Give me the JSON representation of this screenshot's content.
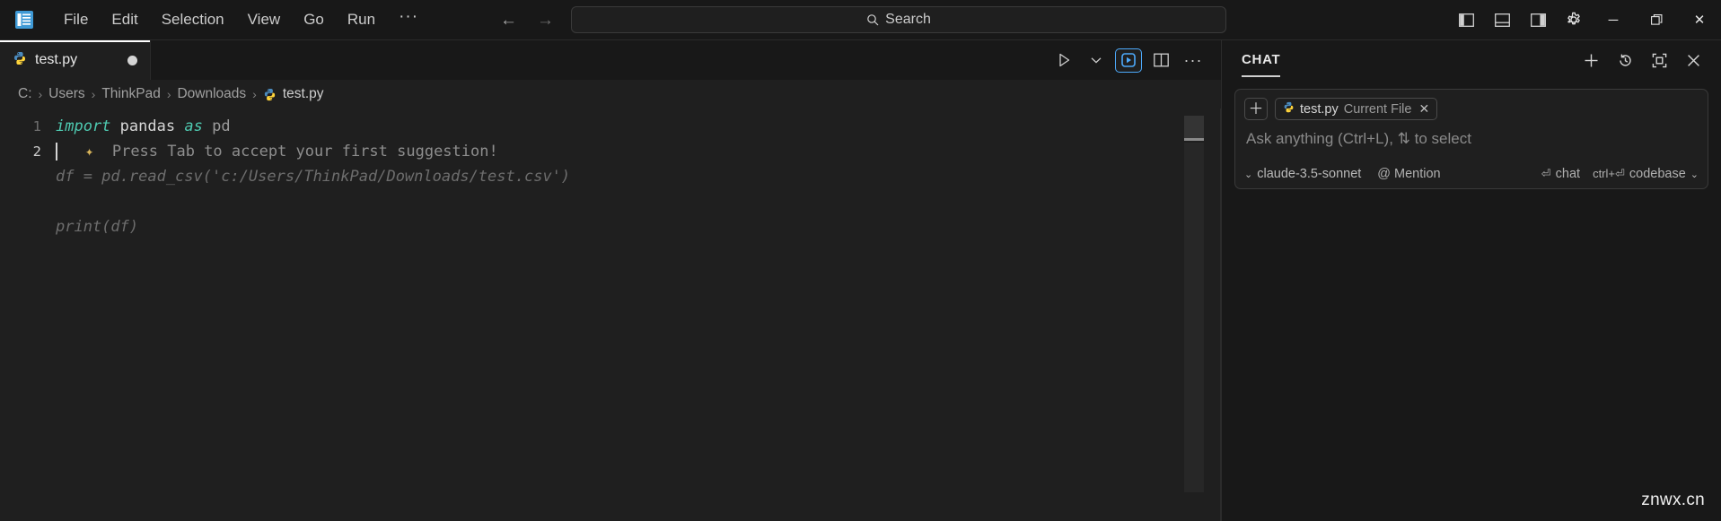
{
  "titlebar": {
    "logo_icon": "vscode-logo-icon",
    "menu": [
      {
        "label": "File",
        "name": "menu-file"
      },
      {
        "label": "Edit",
        "name": "menu-edit"
      },
      {
        "label": "Selection",
        "name": "menu-selection"
      },
      {
        "label": "View",
        "name": "menu-view"
      },
      {
        "label": "Go",
        "name": "menu-go"
      },
      {
        "label": "Run",
        "name": "menu-run"
      }
    ],
    "menu_overflow": "···",
    "nav": {
      "back": "←",
      "forward": "→"
    },
    "search": {
      "label": "Search",
      "icon": "search-icon"
    },
    "layout_icons": [
      "toggle-primary-sidebar-icon",
      "toggle-panel-icon",
      "toggle-secondary-sidebar-icon",
      "gear-icon"
    ],
    "window_controls": {
      "minimize": "─",
      "restore": "❐",
      "close": "✕"
    }
  },
  "tabs": {
    "items": [
      {
        "label": "test.py",
        "icon": "python-file-icon",
        "dirty": true
      }
    ],
    "actions": {
      "run": "▷",
      "run_chevron": "⌄",
      "run_highlight": "run-python-file-icon",
      "split_editor": "split-editor-icon",
      "more": "···"
    }
  },
  "breadcrumb": {
    "items": [
      "C:",
      "Users",
      "ThinkPad",
      "Downloads",
      "test.py"
    ],
    "separator": "›",
    "file_icon": "python-file-icon"
  },
  "editor": {
    "lines": [
      {
        "number": "1",
        "active": false
      },
      {
        "number": "2",
        "active": true
      }
    ],
    "line1": {
      "kw_import": "import",
      "module": "pandas",
      "kw_as": "as",
      "alias": "pd"
    },
    "line2": {
      "sparkle": "✦",
      "hint": "Press Tab to accept your first suggestion!"
    },
    "ghost_lines": [
      "df = pd.read_csv('c:/Users/ThinkPad/Downloads/test.csv')",
      "",
      "print(df)"
    ]
  },
  "chat": {
    "title": "CHAT",
    "header_actions": [
      {
        "name": "new-chat-icon",
        "glyph": "＋"
      },
      {
        "name": "chat-history-icon",
        "glyph": "↺"
      },
      {
        "name": "maximize-chat-icon",
        "glyph": "⬚"
      },
      {
        "name": "close-chat-icon",
        "glyph": "✕"
      }
    ],
    "composer": {
      "add_context": "＋",
      "context_chip": {
        "icon": "python-file-icon",
        "name": "test.py",
        "sub": "Current File",
        "remove": "✕"
      },
      "placeholder": "Ask anything (Ctrl+L), ⇅ to select",
      "model": "claude-3.5-sonnet",
      "model_chevron": "⌄",
      "mention_icon": "@",
      "mention_label": "Mention",
      "submit_hint_key": "⏎",
      "submit_hint_label": "chat",
      "codebase_key": "ctrl+⏎",
      "codebase_label": "codebase",
      "codebase_chevron": "⌄"
    }
  },
  "watermark": "znwx.cn",
  "colors": {
    "accent_blue": "#4daafc",
    "keyword": "#4ec9b0",
    "ghost_text": "#6d6d6d",
    "sparkle": "#d7b45a"
  }
}
